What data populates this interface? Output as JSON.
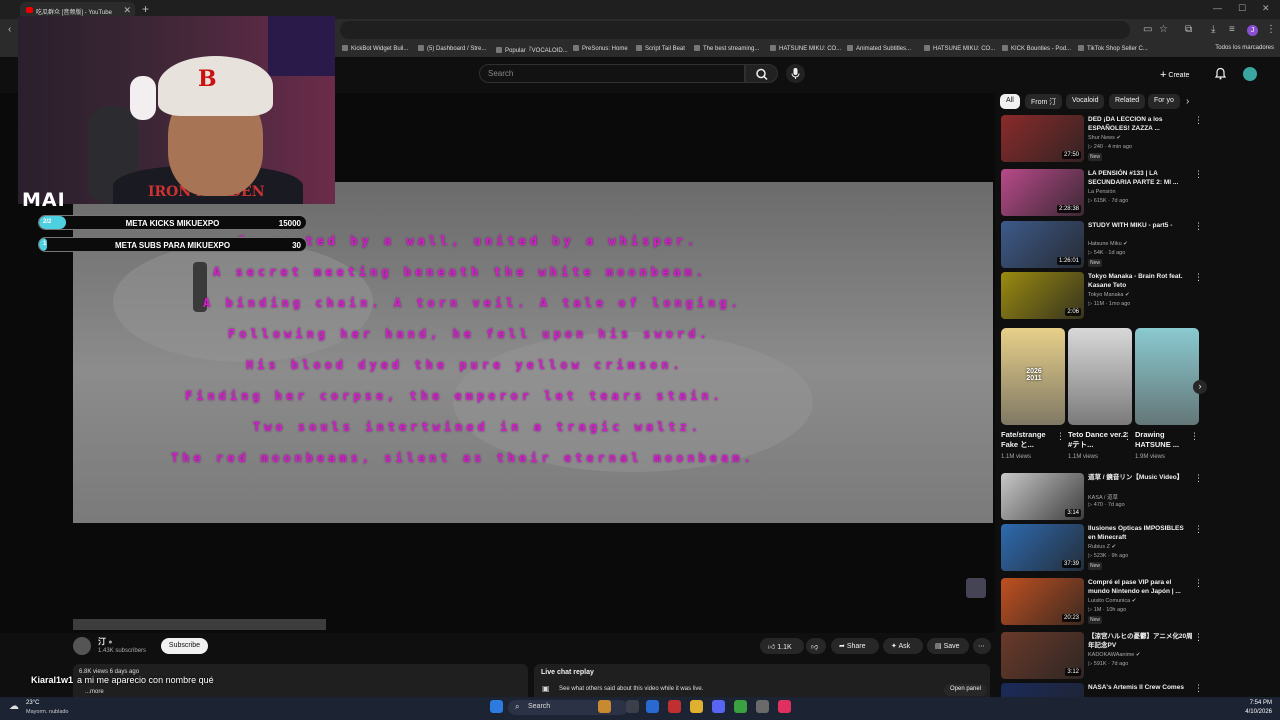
{
  "browser": {
    "tab_title": "吃瓜群众 [音频版] - YouTube",
    "bookmarks": [
      "KickBot Widget Buil...",
      "(5) Dashboard / Stre...",
      "Popular『VOCALOID...",
      "PreSonus: Home",
      "Script Tail Beat",
      "The best streaming...",
      "HATSUNE MIKU: CO...",
      "Animated Subtitles...",
      "HATSUNE MIKU: CO...",
      "KICK Bounties - Pod...",
      "TikTok Shop Seller C..."
    ],
    "bookmarks_folder": "Todos los marcadores",
    "profile_initial": "J"
  },
  "header": {
    "search_placeholder": "Search",
    "create_label": "Create"
  },
  "overlay": {
    "streamer_tag": "MAI",
    "shirt_text": "IRON MAIDEN",
    "kicks": {
      "label": "META KICKS MIKUEXPO",
      "goal": "15000",
      "current": "2/2",
      "progress": 0.1
    },
    "subs": {
      "label": "META SUBS PARA MIKUEXPO",
      "goal": "30",
      "current": "1",
      "progress": 0.03
    },
    "chat_user": "Kiaral1w1",
    "chat_message": "a mi me aparecio con nombre qué"
  },
  "video": {
    "lyrics": [
      "Separated by a wall, united by a whisper.",
      "A secret meeting beneath the white moonbeam.",
      "A binding chain. A torn veil. A tale of longing.",
      "Following her hand, he fell upon his sword.",
      "His blood dyed the pure yellow crimson.",
      "Finding her corpse, the emperor let tears stain.",
      "Two souls intertwined in a tragic waltz.",
      "The red moonbeams, silent as their eternal moonbeam."
    ]
  },
  "below_video": {
    "channel_name": "汀",
    "subscribers": "1.43K subscribers",
    "subscribe_label": "Subscribe",
    "likes": "1.1K",
    "share_label": "Share",
    "ask_label": "Ask",
    "save_label": "Save",
    "description_meta": "6.8K views  6 days ago",
    "description_more": "...more",
    "live_chat_title": "Live chat replay",
    "live_chat_desc": "See what others said about this video while it was live.",
    "open_panel_label": "Open panel"
  },
  "chips": [
    "All",
    "From 汀",
    "Vocaloid",
    "Related",
    "For yo"
  ],
  "recommendations": [
    {
      "title": "DED ¡DA LECCION a los ESPAÑOLES! ZAZZA ...",
      "channel": "Shur News ✔",
      "views": "▷ 240 · 4 min ago",
      "badge": "New",
      "duration": "27:50",
      "color": "#8a2a2a"
    },
    {
      "title": "LA PENSIÓN #133 | LA SECUNDARIA PARTE 2: MI ...",
      "channel": "La Pensión",
      "views": "▷ 615K · 7d ago",
      "badge": "",
      "duration": "2:28:38",
      "color": "#b84a8a"
    },
    {
      "title": "STUDY WITH MIKU - part5 -",
      "channel": "Hatsune Miku ✔",
      "views": "▷ 54K · 1d ago",
      "badge": "New",
      "duration": "1:26:01",
      "color": "#3d5a8a"
    },
    {
      "title": "Tokyo Manaka - Brain Rot feat. Kasane Teto",
      "channel": "Tokyo Manaka ✔",
      "views": "▷ 11M · 1mo ago",
      "badge": "",
      "duration": "2:06",
      "color": "#9a8a10"
    },
    {
      "title": "道草 / 鏡音リン【Music Video】",
      "channel": "KASA / 道草",
      "views": "▷ 470 · 7d ago",
      "badge": "",
      "duration": "3:14",
      "color": "#c8c8c8"
    },
    {
      "title": "Ilusiones Opticas IMPOSIBLES en Minecraft",
      "channel": "Rubius Z ✔",
      "views": "▷ 523K · 9h ago",
      "badge": "New",
      "duration": "37:39",
      "color": "#2e6ab0"
    },
    {
      "title": "Compré el pase VIP para el mundo Nintendo en Japón | ...",
      "channel": "Luisito Comunica ✔",
      "views": "▷ 1M · 10h ago",
      "badge": "New",
      "duration": "20:23",
      "color": "#c05020"
    },
    {
      "title": "【涼宮ハルヒの憂鬱】アニメ化20周年記念PV",
      "channel": "KADOKAWAanime ✔",
      "views": "▷ 591K · 7d ago",
      "badge": "",
      "duration": "3:12",
      "color": "#6a3a2a"
    },
    {
      "title": "NASA's Artemis II Crew Comes",
      "channel": "",
      "views": "",
      "badge": "",
      "duration": "",
      "color": "#1a2a5a"
    }
  ],
  "shorts": [
    {
      "title": "Fate/strange Fake と...",
      "views": "1.1M views",
      "color": "#e8d08a",
      "overlay": "2026 2011"
    },
    {
      "title": "Teto Dance ver.2 #テト...",
      "views": "1.1M views",
      "color": "#d8d8d8",
      "overlay": ""
    },
    {
      "title": "Drawing HATSUNE ...",
      "views": "1.9M views",
      "color": "#8acad0",
      "overlay": ""
    }
  ],
  "taskbar": {
    "temp": "23°C",
    "weather": "Mayorm. nublado",
    "search": "Search",
    "time": "7:54 PM",
    "date": "4/10/2026"
  }
}
